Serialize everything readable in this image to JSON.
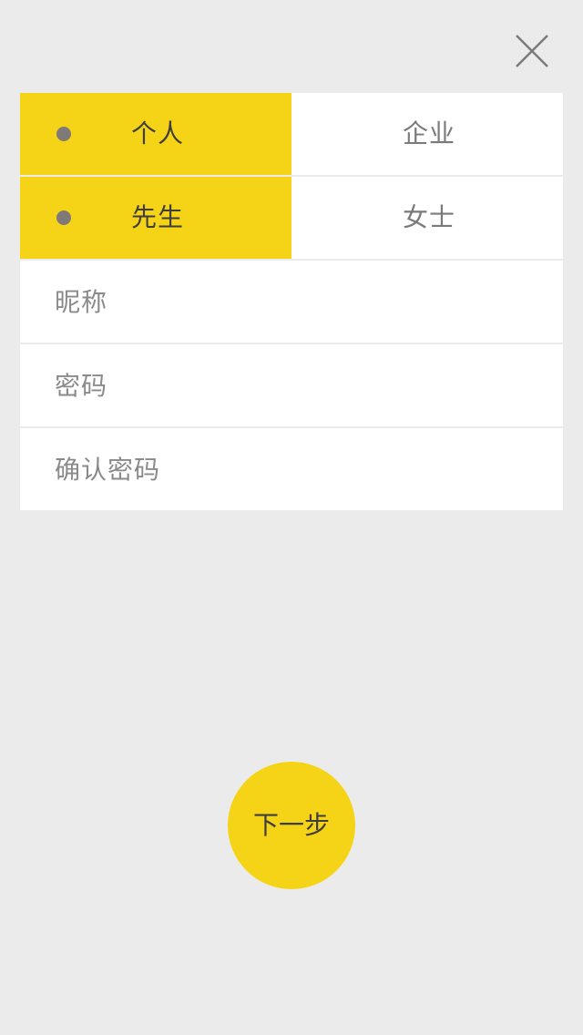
{
  "header": {
    "close_icon": "close-icon"
  },
  "account_type": {
    "options": [
      "个人",
      "企业"
    ],
    "selected": "个人"
  },
  "gender": {
    "options": [
      "先生",
      "女士"
    ],
    "selected": "先生"
  },
  "fields": {
    "nickname": {
      "placeholder": "昵称",
      "value": ""
    },
    "password": {
      "placeholder": "密码",
      "value": ""
    },
    "confirm_password": {
      "placeholder": "确认密码",
      "value": ""
    }
  },
  "next_button": {
    "label": "下一步"
  },
  "colors": {
    "accent": "#f5d317",
    "background": "#ebebeb",
    "surface": "#ffffff",
    "dot": "#7f7a78"
  }
}
